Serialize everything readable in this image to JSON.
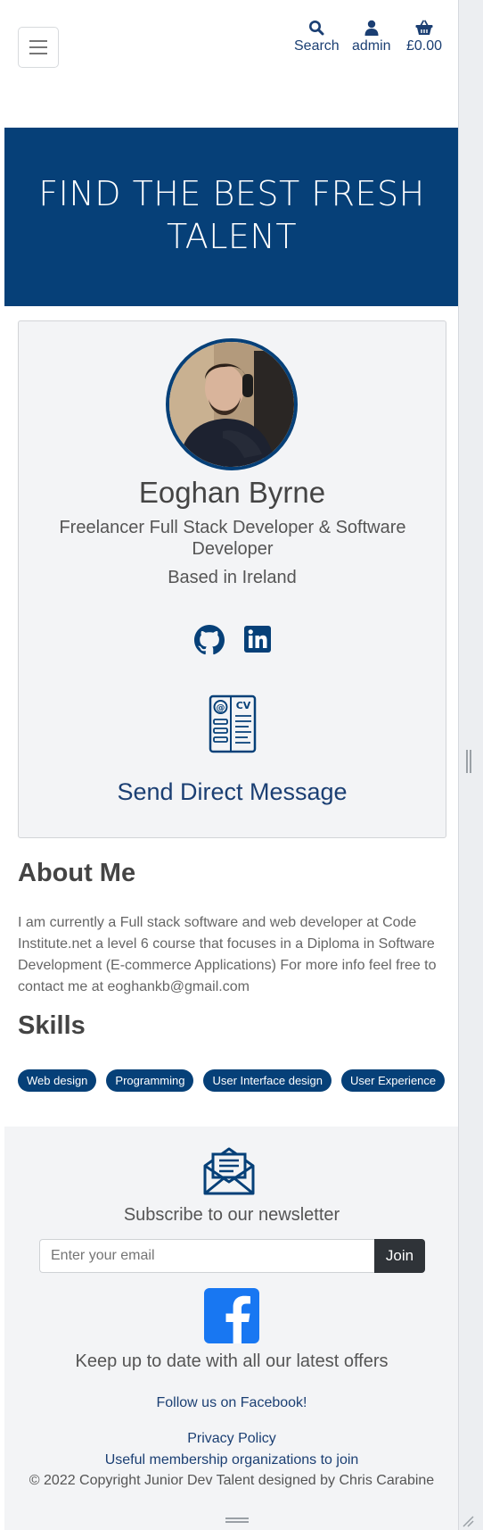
{
  "header": {
    "search_label": "Search",
    "account_label": "admin",
    "cart_label": "£0.00"
  },
  "hero": {
    "title": "FIND THE BEST FRESH TALENT"
  },
  "profile": {
    "name": "Eoghan Byrne",
    "role": "Freelancer Full Stack Developer & Software Developer",
    "location": "Based in Ireland",
    "send_message": "Send Direct Message",
    "cv_icon_text": "CV"
  },
  "about": {
    "title": "About Me",
    "text": "I am currently a Full stack software and web developer at Code Institute.net a level 6 course that focuses in a Diploma in Software Development (E-commerce Applications) For more info feel free to contact me at eoghankb@gmail.com"
  },
  "skills": {
    "title": "Skills",
    "items": [
      "Web design",
      "Programming",
      "User Interface design",
      "User Experience"
    ]
  },
  "footer": {
    "newsletter_title": "Subscribe to our newsletter",
    "email_placeholder": "Enter your email",
    "join_label": "Join",
    "offers_title": "Keep up to date with all our latest offers",
    "follow_link": "Follow us on Facebook!",
    "privacy_link": "Privacy Policy",
    "membership_link": "Useful membership organizations to join",
    "copyright": "© 2022 Copyright Junior Dev Talent designed by Chris Carabine"
  },
  "colors": {
    "brand": "#064078",
    "link": "#1b3f73",
    "footer_bg": "#f3f4f6",
    "facebook": "#1877f2"
  }
}
